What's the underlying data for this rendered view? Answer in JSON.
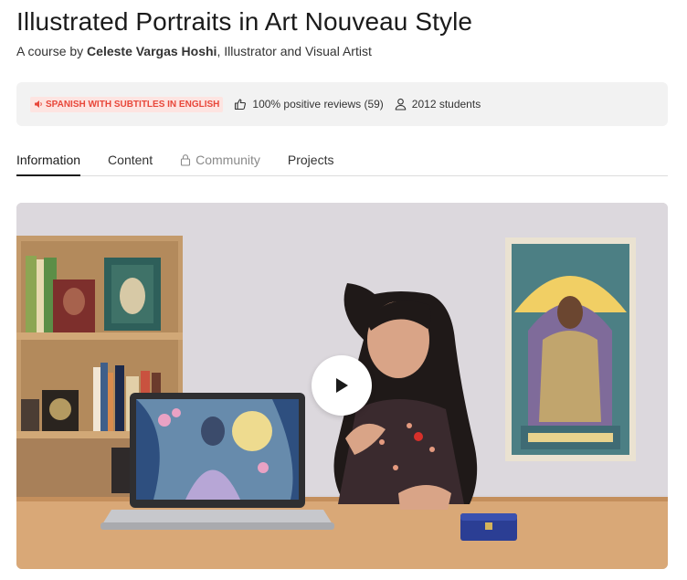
{
  "course": {
    "title": "Illustrated Portraits in Art Nouveau Style",
    "byline_prefix": "A course by ",
    "author": "Celeste Vargas Hoshi",
    "author_role": ", Illustrator and Visual Artist"
  },
  "meta": {
    "language_badge": "SPANISH WITH SUBTITLES IN ENGLISH",
    "reviews": "100% positive reviews (59)",
    "students": "2012 students"
  },
  "tabs": [
    {
      "label": "Information",
      "active": true
    },
    {
      "label": "Content",
      "active": false
    },
    {
      "label": "Community",
      "locked": true
    },
    {
      "label": "Projects",
      "active": false
    }
  ],
  "video": {
    "laptop_icon": "laptop-illustration",
    "play_icon": "play-icon"
  },
  "colors": {
    "badge_bg": "#fde4e1",
    "badge_text": "#e8473a",
    "meta_bg": "#f2f2f2"
  }
}
